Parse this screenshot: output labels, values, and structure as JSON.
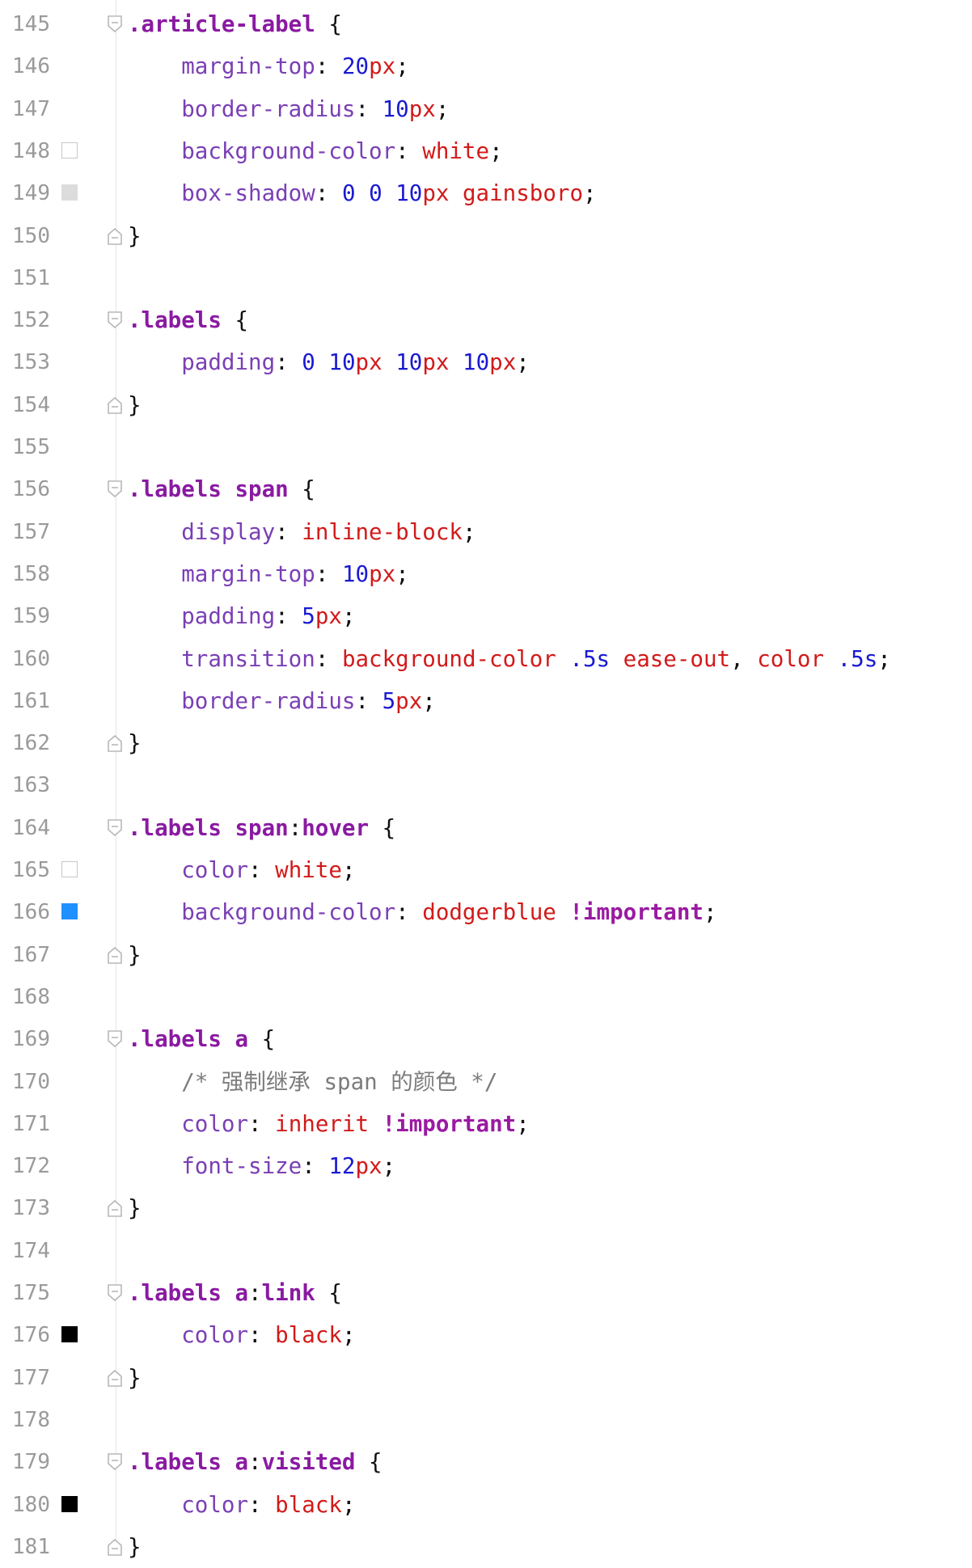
{
  "editor": {
    "language": "css",
    "lines": [
      {
        "no": "145",
        "fold": "open",
        "segments": [
          {
            "t": ".article-label",
            "c": "sel"
          },
          {
            "t": " {",
            "c": "punct"
          }
        ]
      },
      {
        "no": "146",
        "segments": [
          {
            "t": "    ",
            "c": "ws"
          },
          {
            "t": "margin-top",
            "c": "prop"
          },
          {
            "t": ": ",
            "c": "punct"
          },
          {
            "t": "20",
            "c": "num"
          },
          {
            "t": "px",
            "c": "val"
          },
          {
            "t": ";",
            "c": "punct"
          }
        ]
      },
      {
        "no": "147",
        "segments": [
          {
            "t": "    ",
            "c": "ws"
          },
          {
            "t": "border-radius",
            "c": "prop"
          },
          {
            "t": ": ",
            "c": "punct"
          },
          {
            "t": "10",
            "c": "num"
          },
          {
            "t": "px",
            "c": "val"
          },
          {
            "t": ";",
            "c": "punct"
          }
        ]
      },
      {
        "no": "148",
        "swatch": {
          "color": "#ffffff",
          "name": "white"
        },
        "segments": [
          {
            "t": "    ",
            "c": "ws"
          },
          {
            "t": "background-color",
            "c": "prop"
          },
          {
            "t": ": ",
            "c": "punct"
          },
          {
            "t": "white",
            "c": "val"
          },
          {
            "t": ";",
            "c": "punct"
          }
        ]
      },
      {
        "no": "149",
        "swatch": {
          "color": "#dcdcdc",
          "name": "gainsboro"
        },
        "segments": [
          {
            "t": "    ",
            "c": "ws"
          },
          {
            "t": "box-shadow",
            "c": "prop"
          },
          {
            "t": ": ",
            "c": "punct"
          },
          {
            "t": "0",
            "c": "num"
          },
          {
            "t": " ",
            "c": "ws"
          },
          {
            "t": "0",
            "c": "num"
          },
          {
            "t": " ",
            "c": "ws"
          },
          {
            "t": "10",
            "c": "num"
          },
          {
            "t": "px",
            "c": "val"
          },
          {
            "t": " ",
            "c": "ws"
          },
          {
            "t": "gainsboro",
            "c": "val"
          },
          {
            "t": ";",
            "c": "punct"
          }
        ]
      },
      {
        "no": "150",
        "fold": "close",
        "segments": [
          {
            "t": "}",
            "c": "punct"
          }
        ]
      },
      {
        "no": "151",
        "segments": []
      },
      {
        "no": "152",
        "fold": "open",
        "segments": [
          {
            "t": ".labels",
            "c": "sel"
          },
          {
            "t": " {",
            "c": "punct"
          }
        ]
      },
      {
        "no": "153",
        "segments": [
          {
            "t": "    ",
            "c": "ws"
          },
          {
            "t": "padding",
            "c": "prop"
          },
          {
            "t": ": ",
            "c": "punct"
          },
          {
            "t": "0",
            "c": "num"
          },
          {
            "t": " ",
            "c": "ws"
          },
          {
            "t": "10",
            "c": "num"
          },
          {
            "t": "px",
            "c": "val"
          },
          {
            "t": " ",
            "c": "ws"
          },
          {
            "t": "10",
            "c": "num"
          },
          {
            "t": "px",
            "c": "val"
          },
          {
            "t": " ",
            "c": "ws"
          },
          {
            "t": "10",
            "c": "num"
          },
          {
            "t": "px",
            "c": "val"
          },
          {
            "t": ";",
            "c": "punct"
          }
        ]
      },
      {
        "no": "154",
        "fold": "close",
        "segments": [
          {
            "t": "}",
            "c": "punct"
          }
        ]
      },
      {
        "no": "155",
        "segments": []
      },
      {
        "no": "156",
        "fold": "open",
        "segments": [
          {
            "t": ".labels span",
            "c": "sel"
          },
          {
            "t": " {",
            "c": "punct"
          }
        ]
      },
      {
        "no": "157",
        "segments": [
          {
            "t": "    ",
            "c": "ws"
          },
          {
            "t": "display",
            "c": "prop"
          },
          {
            "t": ": ",
            "c": "punct"
          },
          {
            "t": "inline-block",
            "c": "val"
          },
          {
            "t": ";",
            "c": "punct"
          }
        ]
      },
      {
        "no": "158",
        "segments": [
          {
            "t": "    ",
            "c": "ws"
          },
          {
            "t": "margin-top",
            "c": "prop"
          },
          {
            "t": ": ",
            "c": "punct"
          },
          {
            "t": "10",
            "c": "num"
          },
          {
            "t": "px",
            "c": "val"
          },
          {
            "t": ";",
            "c": "punct"
          }
        ]
      },
      {
        "no": "159",
        "segments": [
          {
            "t": "    ",
            "c": "ws"
          },
          {
            "t": "padding",
            "c": "prop"
          },
          {
            "t": ": ",
            "c": "punct"
          },
          {
            "t": "5",
            "c": "num"
          },
          {
            "t": "px",
            "c": "val"
          },
          {
            "t": ";",
            "c": "punct"
          }
        ]
      },
      {
        "no": "160",
        "segments": [
          {
            "t": "    ",
            "c": "ws"
          },
          {
            "t": "transition",
            "c": "prop"
          },
          {
            "t": ": ",
            "c": "punct"
          },
          {
            "t": "background-color",
            "c": "val"
          },
          {
            "t": " ",
            "c": "ws"
          },
          {
            "t": ".5s",
            "c": "num"
          },
          {
            "t": " ",
            "c": "ws"
          },
          {
            "t": "ease-out",
            "c": "val"
          },
          {
            "t": ", ",
            "c": "punct"
          },
          {
            "t": "color",
            "c": "val"
          },
          {
            "t": " ",
            "c": "ws"
          },
          {
            "t": ".5s",
            "c": "num"
          },
          {
            "t": ";",
            "c": "punct"
          }
        ]
      },
      {
        "no": "161",
        "segments": [
          {
            "t": "    ",
            "c": "ws"
          },
          {
            "t": "border-radius",
            "c": "prop"
          },
          {
            "t": ": ",
            "c": "punct"
          },
          {
            "t": "5",
            "c": "num"
          },
          {
            "t": "px",
            "c": "val"
          },
          {
            "t": ";",
            "c": "punct"
          }
        ]
      },
      {
        "no": "162",
        "fold": "close",
        "segments": [
          {
            "t": "}",
            "c": "punct"
          }
        ]
      },
      {
        "no": "163",
        "segments": []
      },
      {
        "no": "164",
        "fold": "open",
        "segments": [
          {
            "t": ".labels span",
            "c": "sel"
          },
          {
            "t": ":",
            "c": "punct"
          },
          {
            "t": "hover",
            "c": "sel"
          },
          {
            "t": " {",
            "c": "punct"
          }
        ]
      },
      {
        "no": "165",
        "swatch": {
          "color": "#ffffff",
          "name": "white"
        },
        "segments": [
          {
            "t": "    ",
            "c": "ws"
          },
          {
            "t": "color",
            "c": "prop"
          },
          {
            "t": ": ",
            "c": "punct"
          },
          {
            "t": "white",
            "c": "val"
          },
          {
            "t": ";",
            "c": "punct"
          }
        ]
      },
      {
        "no": "166",
        "swatch": {
          "color": "#1e90ff",
          "name": "dodgerblue"
        },
        "segments": [
          {
            "t": "    ",
            "c": "ws"
          },
          {
            "t": "background-color",
            "c": "prop"
          },
          {
            "t": ": ",
            "c": "punct"
          },
          {
            "t": "dodgerblue",
            "c": "val"
          },
          {
            "t": " ",
            "c": "ws"
          },
          {
            "t": "!important",
            "c": "imp"
          },
          {
            "t": ";",
            "c": "punct"
          }
        ]
      },
      {
        "no": "167",
        "fold": "close",
        "segments": [
          {
            "t": "}",
            "c": "punct"
          }
        ]
      },
      {
        "no": "168",
        "segments": []
      },
      {
        "no": "169",
        "fold": "open",
        "segments": [
          {
            "t": ".labels a",
            "c": "sel"
          },
          {
            "t": " {",
            "c": "punct"
          }
        ]
      },
      {
        "no": "170",
        "segments": [
          {
            "t": "    ",
            "c": "ws"
          },
          {
            "t": "/* ",
            "c": "cmt"
          },
          {
            "t": "强制继承",
            "c": "cmt cjk"
          },
          {
            "t": " span ",
            "c": "cmt"
          },
          {
            "t": "的颜色",
            "c": "cmt cjk"
          },
          {
            "t": " */",
            "c": "cmt"
          }
        ]
      },
      {
        "no": "171",
        "segments": [
          {
            "t": "    ",
            "c": "ws"
          },
          {
            "t": "color",
            "c": "prop"
          },
          {
            "t": ": ",
            "c": "punct"
          },
          {
            "t": "inherit",
            "c": "val"
          },
          {
            "t": " ",
            "c": "ws"
          },
          {
            "t": "!important",
            "c": "imp"
          },
          {
            "t": ";",
            "c": "punct"
          }
        ]
      },
      {
        "no": "172",
        "segments": [
          {
            "t": "    ",
            "c": "ws"
          },
          {
            "t": "font-size",
            "c": "prop"
          },
          {
            "t": ": ",
            "c": "punct"
          },
          {
            "t": "12",
            "c": "num"
          },
          {
            "t": "px",
            "c": "val"
          },
          {
            "t": ";",
            "c": "punct"
          }
        ]
      },
      {
        "no": "173",
        "fold": "close",
        "segments": [
          {
            "t": "}",
            "c": "punct"
          }
        ]
      },
      {
        "no": "174",
        "segments": []
      },
      {
        "no": "175",
        "fold": "open",
        "segments": [
          {
            "t": ".labels a",
            "c": "sel"
          },
          {
            "t": ":",
            "c": "punct"
          },
          {
            "t": "link",
            "c": "sel"
          },
          {
            "t": " {",
            "c": "punct"
          }
        ]
      },
      {
        "no": "176",
        "swatch": {
          "color": "#000000",
          "name": "black"
        },
        "segments": [
          {
            "t": "    ",
            "c": "ws"
          },
          {
            "t": "color",
            "c": "prop"
          },
          {
            "t": ": ",
            "c": "punct"
          },
          {
            "t": "black",
            "c": "val"
          },
          {
            "t": ";",
            "c": "punct"
          }
        ]
      },
      {
        "no": "177",
        "fold": "close",
        "segments": [
          {
            "t": "}",
            "c": "punct"
          }
        ]
      },
      {
        "no": "178",
        "segments": []
      },
      {
        "no": "179",
        "fold": "open",
        "segments": [
          {
            "t": ".labels a",
            "c": "sel"
          },
          {
            "t": ":",
            "c": "punct"
          },
          {
            "t": "visited",
            "c": "sel"
          },
          {
            "t": " {",
            "c": "punct"
          }
        ]
      },
      {
        "no": "180",
        "swatch": {
          "color": "#000000",
          "name": "black"
        },
        "segments": [
          {
            "t": "    ",
            "c": "ws"
          },
          {
            "t": "color",
            "c": "prop"
          },
          {
            "t": ": ",
            "c": "punct"
          },
          {
            "t": "black",
            "c": "val"
          },
          {
            "t": ";",
            "c": "punct"
          }
        ]
      },
      {
        "no": "181",
        "fold": "close",
        "segments": [
          {
            "t": "}",
            "c": "punct"
          }
        ]
      }
    ]
  }
}
